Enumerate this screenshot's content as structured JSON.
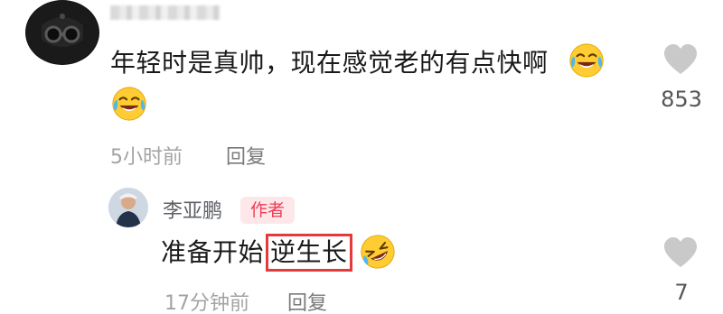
{
  "comment": {
    "text": "年轻时是真帅，现在感觉老的有点快啊",
    "time": "5小时前",
    "reply_label": "回复",
    "likes": "853",
    "emoji": "laughing-tears-emoji"
  },
  "reply": {
    "username": "李亚鹏",
    "badge": "作者",
    "text_prefix": "准备开始",
    "text_highlight": "逆生长",
    "time": "17分钟前",
    "reply_label": "回复",
    "likes": "7",
    "emoji": "rolling-laughing-emoji"
  },
  "colors": {
    "badge_text": "#f03d55",
    "badge_bg": "#fde7e9",
    "highlight_border": "#e33b3b",
    "meta_text": "#a3a3a3"
  }
}
